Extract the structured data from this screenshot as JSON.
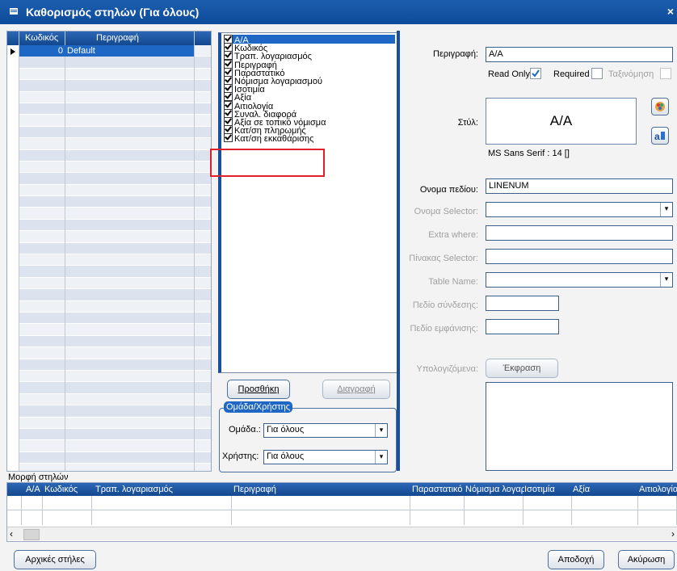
{
  "window": {
    "title": "Καθορισμός στηλών  (Για όλους)",
    "close": "×"
  },
  "left_grid": {
    "columns": [
      "Κωδικός",
      "Περιγραφή"
    ],
    "rows": [
      {
        "code": "0",
        "desc": "Default"
      }
    ]
  },
  "columns_list": {
    "items": [
      {
        "label": "A/A",
        "checked": true,
        "selected": true
      },
      {
        "label": "Κωδικός",
        "checked": true
      },
      {
        "label": "Τραπ. λογαριασμός",
        "checked": true
      },
      {
        "label": "Περιγραφή",
        "checked": true
      },
      {
        "label": "Παραστατικό",
        "checked": true
      },
      {
        "label": "Νόμισμα λογαριασμού",
        "checked": true
      },
      {
        "label": "Ισοτιμία",
        "checked": true
      },
      {
        "label": "Αξία",
        "checked": true
      },
      {
        "label": "Αιτιολογία",
        "checked": true
      },
      {
        "label": "Συναλ. διαφορά",
        "checked": true
      },
      {
        "label": "Αξία σε τοπικό νόμισμα",
        "checked": true
      },
      {
        "label": "Κατ/ση πληρωμής",
        "checked": true
      },
      {
        "label": "Κατ/ση εκκαθάρισης",
        "checked": true
      }
    ],
    "add_button": "Προσθήκη",
    "delete_button": "Διαγραφή"
  },
  "group_user": {
    "title": "Ομάδα/Χρήστης",
    "group_label": "Ομάδα.:",
    "group_value": "Για όλους",
    "user_label": "Χρήστης:",
    "user_value": "Για όλους"
  },
  "props": {
    "description_label": "Περιγραφή:",
    "description_value": "A/A",
    "readonly_label": "Read Only",
    "readonly_checked": true,
    "required_label": "Required",
    "required_checked": false,
    "sort_label": "Ταξινόμηση",
    "style_label": "Στύλ:",
    "style_preview": "A/A",
    "font_info": "MS Sans Serif : 14  []",
    "field_name_label": "Ονομα πεδίου:",
    "field_name_value": "LINENUM",
    "selector_name_label": "Ονομα Selector:",
    "extra_where_label": "Extra where:",
    "selector_table_label": "Πίνακας Selector:",
    "table_name_label": "Table Name:",
    "link_field_label": "Πεδίο σύνδεσης:",
    "display_field_label": "Πεδίο εμφάνισης:",
    "computed_label": "Υπολογιζόμενα:",
    "expression_button": "Έκφραση"
  },
  "bottom": {
    "section_label": "Μορφή στηλών",
    "columns": [
      "A/A",
      "Κωδικός",
      "Τραπ. λογαριασμός",
      "Περιγραφή",
      "Παραστατικό",
      "Νόμισμα λογαρ",
      "Ισοτιμία",
      "Αξία",
      "Αιτιολογία"
    ],
    "initial_columns_button": "Αρχικές στήλες",
    "accept_button": "Αποδοχή",
    "cancel_button": "Ακύρωση"
  }
}
